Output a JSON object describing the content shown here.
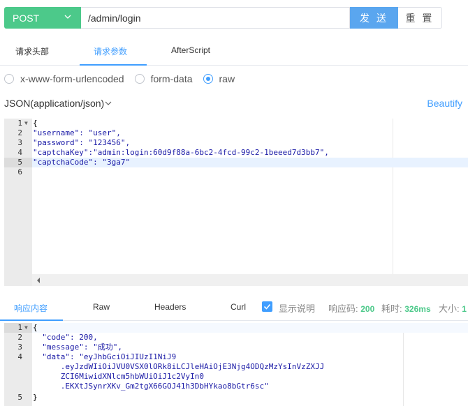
{
  "request": {
    "method": "POST",
    "url": "/admin/login",
    "send_label": "发 送",
    "reset_label": "重 置"
  },
  "tabs": [
    {
      "label": "请求头部"
    },
    {
      "label": "请求参数"
    },
    {
      "label": "AfterScript"
    }
  ],
  "body_types": [
    {
      "label": "x-www-form-urlencoded",
      "checked": false
    },
    {
      "label": "form-data",
      "checked": false
    },
    {
      "label": "raw",
      "checked": true
    }
  ],
  "content_type": "JSON(application/json)",
  "beautify_label": "Beautify",
  "request_editor": {
    "lines": [
      {
        "num": "1",
        "text": "{"
      },
      {
        "num": "2",
        "text": "\"username\": \"user\","
      },
      {
        "num": "3",
        "text": "\"password\": \"123456\","
      },
      {
        "num": "4",
        "text": "\"captchaKey\":\"admin:login:60d9f88a-6bc2-4fcd-99c2-1beeed7d3bb7\","
      },
      {
        "num": "5",
        "text": "\"captchaCode\": \"3ga7\""
      },
      {
        "num": "6",
        "text": ""
      }
    ]
  },
  "response_tabs": [
    {
      "label": "响应内容"
    },
    {
      "label": "Raw"
    },
    {
      "label": "Headers"
    },
    {
      "label": "Curl"
    }
  ],
  "response_meta": {
    "show_desc_label": "显示说明",
    "status_label": "响应码:",
    "status_value": "200",
    "time_label": "耗时:",
    "time_value": "326ms",
    "size_label": "大小:",
    "size_value": "1"
  },
  "response_editor": {
    "lines": [
      {
        "num": "1",
        "text": "{"
      },
      {
        "num": "2",
        "text": "  \"code\": 200,"
      },
      {
        "num": "3",
        "text": "  \"message\": \"成功\","
      },
      {
        "num": "4",
        "text": "  \"data\": \"eyJhbGciOiJIUzI1NiJ9"
      },
      {
        "num": "",
        "text": "      .eyJzdWIiOiJVU0VSX0lORk8iLCJleHAiOjE3Njg4ODQzMzYsInVzZXJJ"
      },
      {
        "num": "",
        "text": "      ZCI6MiwidXNlcm5hbWUiOiJ1c2VyIn0"
      },
      {
        "num": "",
        "text": "      .EKXtJSynrXKv_Gm2tgX66GOJ41h3DbHYkao8bGtr6sc\""
      },
      {
        "num": "5",
        "text": "}"
      }
    ]
  }
}
